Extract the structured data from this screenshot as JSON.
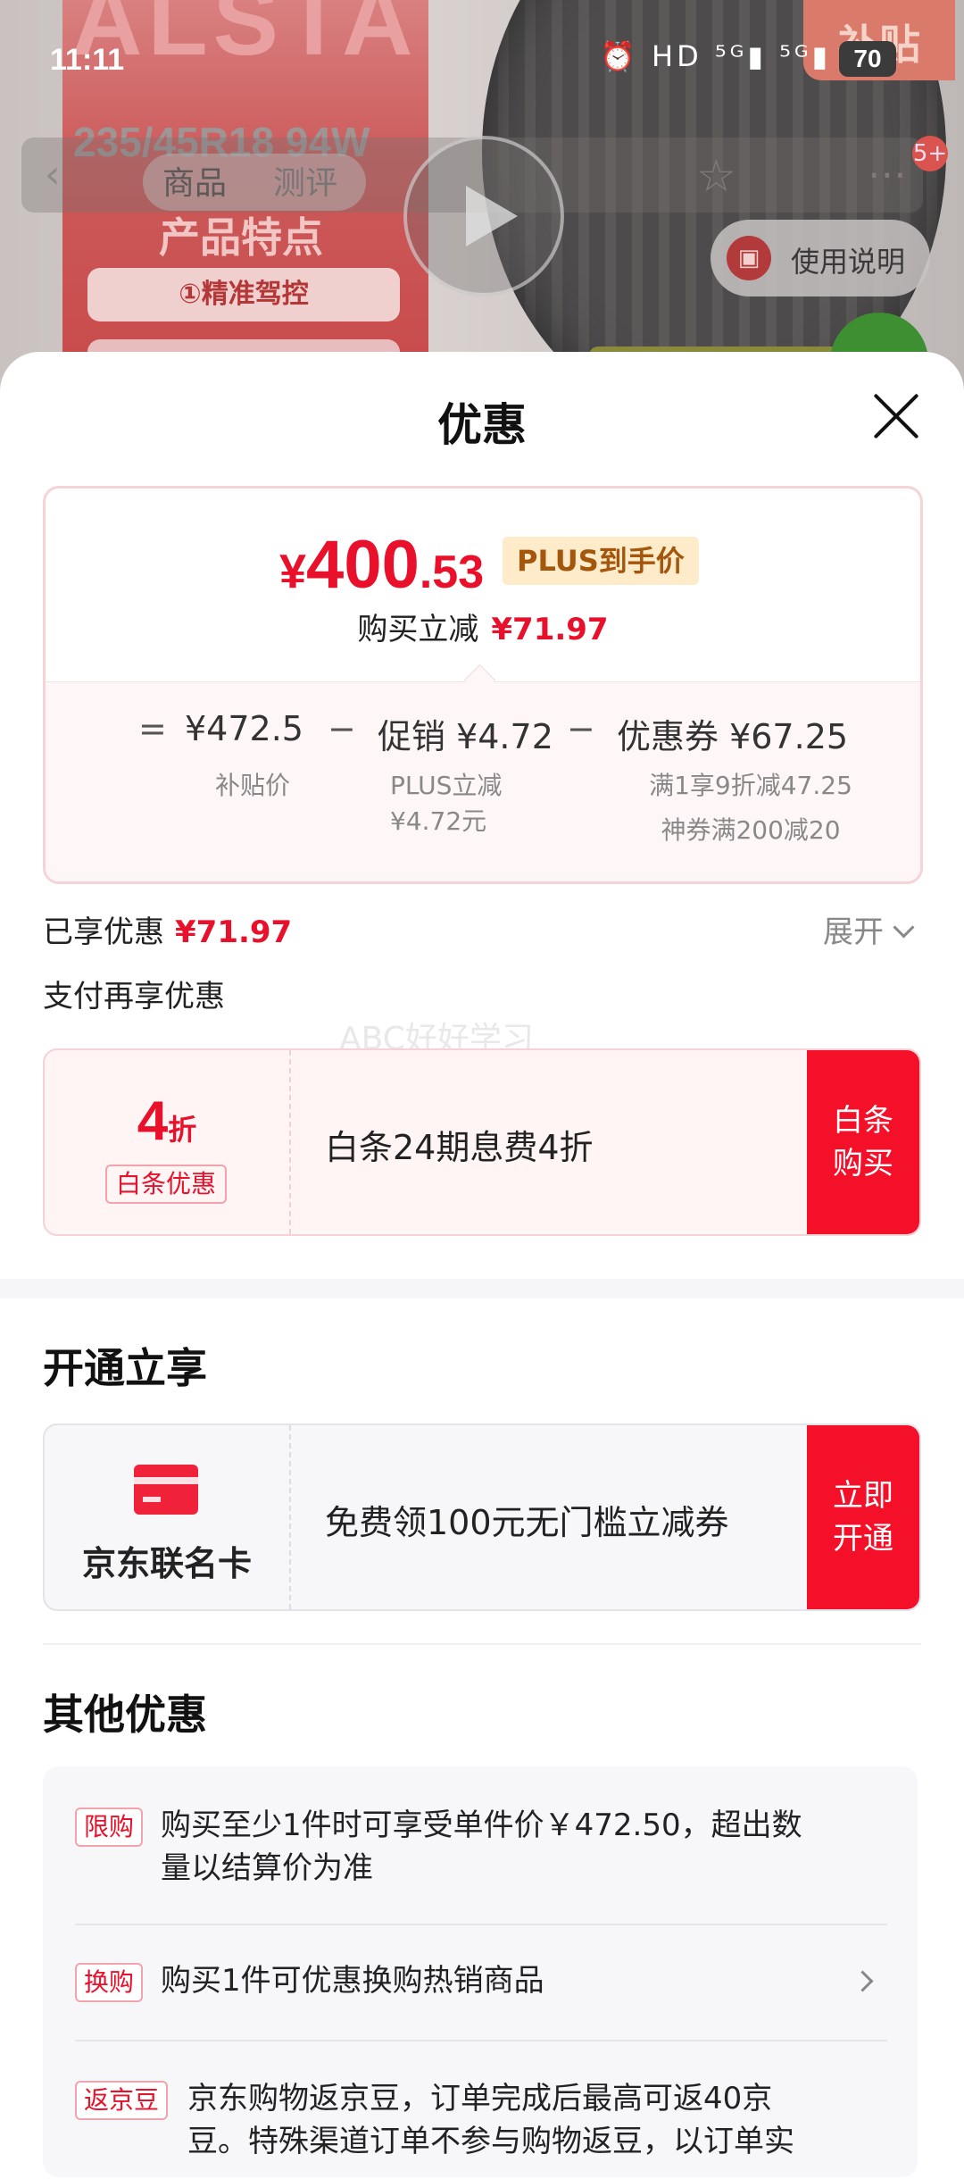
{
  "status_bar": {
    "time": "11:11",
    "indicators": "⏰ HD ⁵ᴳ▮ ⁵ᴳ▮",
    "battery": "70"
  },
  "background": {
    "brand_text": "ALSTA",
    "tire_size": "235/45R18 94W",
    "feature_title": "产品特点",
    "feature_pill": "①精准驾控",
    "corner_tag": "补贴",
    "tab_product": "商品",
    "tab_review": "测评",
    "cart_badge": "5+",
    "manual_label": "使用说明"
  },
  "sheet": {
    "title": "优惠"
  },
  "price_card": {
    "final_yen": "¥",
    "final_int": "400",
    "final_dec": ".53",
    "plus_tag": "PLUS到手价",
    "reduce_label": "购买立减",
    "reduce_amount": "¥71.97",
    "breakdown": {
      "eq": "=",
      "base": "¥472.5",
      "base_label": "补贴价",
      "minus1": "−",
      "promo": "促销 ¥4.72",
      "promo_label_1": "PLUS立减",
      "promo_label_2": "¥4.72元",
      "minus2": "−",
      "coupon": "优惠券 ¥67.25",
      "coupon_label_1": "满1享9折减47.25",
      "coupon_label_2": "神券满200减20"
    }
  },
  "enjoyed": {
    "label": "已享优惠",
    "amount": "¥71.97",
    "expand": "展开"
  },
  "pay_more": "支付再享优惠",
  "watermark": "ABC好好学习",
  "baitiao": {
    "discount_num": "4",
    "discount_unit": "折",
    "discount_label": "白条优惠",
    "description": "白条24期息费4折",
    "button_line1": "白条",
    "button_line2": "购买"
  },
  "open_section": {
    "title": "开通立享",
    "card_name": "京东联名卡",
    "description": "免费领100元无门槛立减券",
    "button_line1": "立即",
    "button_line2": "开通"
  },
  "other_section": {
    "title": "其他优惠",
    "items": [
      {
        "tag": "限购",
        "text_1": "购买至少1件时可享受单件价￥472.50，超出数",
        "text_2": "量以结算价为准"
      },
      {
        "tag": "换购",
        "text_1": "购买1件可优惠换购热销商品"
      },
      {
        "tag": "返京豆",
        "text_1": "京东购物返京豆，订单完成后最高可返40京",
        "text_2": "豆。特殊渠道订单不参与购物返豆，以订单实"
      }
    ]
  },
  "colors": {
    "accent_red": "#e8102a",
    "button_red": "#f5102a",
    "plus_bg": "#fdebc9"
  }
}
